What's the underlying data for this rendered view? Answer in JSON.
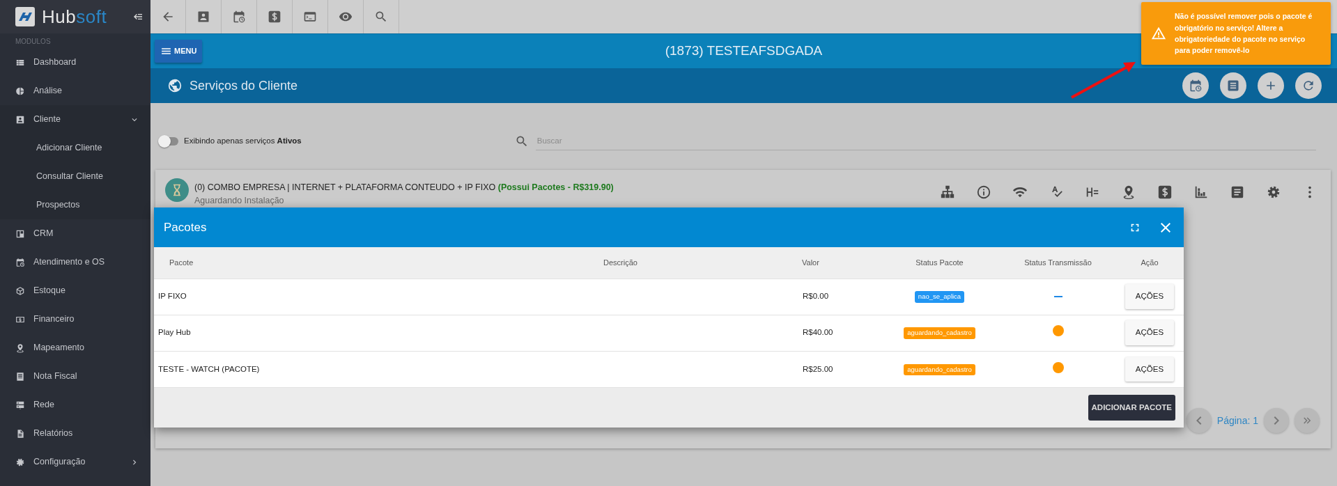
{
  "sidebar": {
    "brand": "Hub",
    "brand_accent": "soft",
    "section": "MODULOS",
    "items": [
      {
        "label": "Dashboard"
      },
      {
        "label": "Análise"
      },
      {
        "label": "Cliente",
        "expanded": true,
        "children": [
          {
            "label": "Adicionar Cliente"
          },
          {
            "label": "Consultar Cliente"
          },
          {
            "label": "Prospectos"
          }
        ]
      },
      {
        "label": "CRM"
      },
      {
        "label": "Atendimento e OS"
      },
      {
        "label": "Estoque"
      },
      {
        "label": "Financeiro"
      },
      {
        "label": "Mapeamento"
      },
      {
        "label": "Nota Fiscal"
      },
      {
        "label": "Rede"
      },
      {
        "label": "Relatórios"
      },
      {
        "label": "Configuração",
        "expanded": false
      }
    ]
  },
  "topbar": {
    "menu_button": "MENU",
    "client_title": "(1873) TESTEAFSDGADA"
  },
  "section_header": {
    "title": "Serviços do Cliente"
  },
  "filter": {
    "toggle": {
      "on": false,
      "label": "Exibindo apenas serviços **Ativos**"
    },
    "search": {
      "placeholder": "Buscar"
    }
  },
  "service": {
    "title": "(0) COMBO EMPRESA | INTERNET + PLATAFORMA CONTEUDO + IP FIXO",
    "packages_note": "(Possui Pacotes - R$319.90)",
    "status": "Aguardando Instalação"
  },
  "pagination": {
    "label": "Página: 1"
  },
  "modal": {
    "title": "Pacotes",
    "columns": [
      "Pacote",
      "Descrição",
      "Valor",
      "Status Pacote",
      "Status Transmissão",
      "Ação"
    ],
    "rows": [
      {
        "pacote": "IP FIXO",
        "valor": "R$0.00",
        "status": {
          "label": "nao_se_aplica",
          "color": "#2196f3"
        },
        "transmission": {
          "kind": "dash"
        },
        "action": "AÇÕES"
      },
      {
        "pacote": "Play Hub",
        "valor": "R$40.00",
        "status": {
          "label": "aguardando_cadastro",
          "color": "#ff9800"
        },
        "transmission": {
          "kind": "dot",
          "color": "#ff9800"
        },
        "action": "AÇÕES"
      },
      {
        "pacote": "TESTE - WATCH (PACOTE)",
        "valor": "R$25.00",
        "status": {
          "label": "aguardando_cadastro",
          "color": "#ff9800"
        },
        "transmission": {
          "kind": "dot",
          "color": "#ff9800"
        },
        "action": "AÇÕES"
      }
    ],
    "add_button": "ADICIONAR PACOTE"
  },
  "toast": {
    "kind": "warning",
    "message": "Não é possível remover pois o pacote é obrigatório no serviço! Altere a obrigatoriedade do pacote no serviço para poder removê-lo"
  }
}
